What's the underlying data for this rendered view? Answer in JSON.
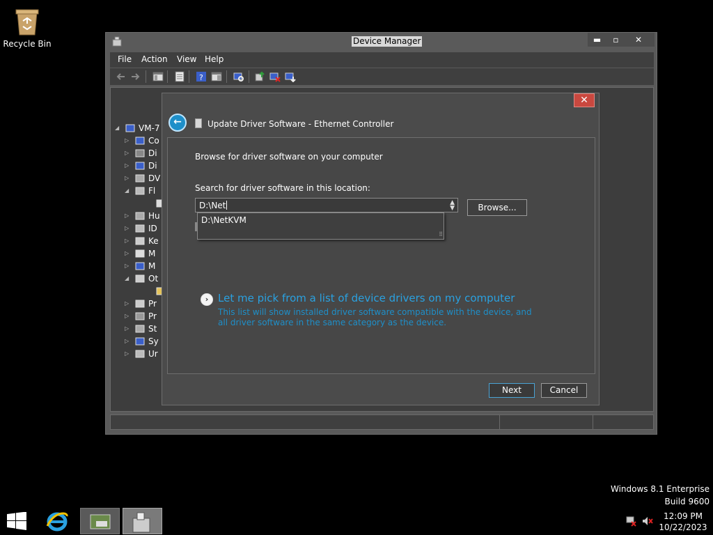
{
  "desktop": {
    "recycle_bin_label": "Recycle Bin"
  },
  "device_manager": {
    "title": "Device Manager",
    "window_buttons": {
      "minimize": "▬",
      "maximize": "▫",
      "close": "✕"
    },
    "menu": [
      "File",
      "Action",
      "View",
      "Help"
    ],
    "tree": [
      {
        "label": "VM-7",
        "arrow": "◢",
        "icon": "computer-icon"
      },
      {
        "label": "Co",
        "arrow": "▷",
        "icon": "computer-icon"
      },
      {
        "label": "Di",
        "arrow": "▷",
        "icon": "disk-drive-icon"
      },
      {
        "label": "Di",
        "arrow": "▷",
        "icon": "display-adapter-icon"
      },
      {
        "label": "DV",
        "arrow": "▷",
        "icon": "dvd-drive-icon"
      },
      {
        "label": "Fl",
        "arrow": "◢",
        "icon": "floppy-controller-icon"
      },
      {
        "label": "",
        "arrow": "",
        "icon": "floppy-drive-icon"
      },
      {
        "label": "Hu",
        "arrow": "▷",
        "icon": "hid-icon"
      },
      {
        "label": "ID",
        "arrow": "▷",
        "icon": "ide-controller-icon"
      },
      {
        "label": "Ke",
        "arrow": "▷",
        "icon": "keyboard-icon"
      },
      {
        "label": "M",
        "arrow": "▷",
        "icon": "mouse-icon"
      },
      {
        "label": "M",
        "arrow": "▷",
        "icon": "monitor-icon"
      },
      {
        "label": "Ot",
        "arrow": "◢",
        "icon": "other-devices-icon"
      },
      {
        "label": "",
        "arrow": "",
        "icon": "unknown-device-warning-icon"
      },
      {
        "label": "Pr",
        "arrow": "▷",
        "icon": "printer-icon"
      },
      {
        "label": "Pr",
        "arrow": "▷",
        "icon": "processor-icon"
      },
      {
        "label": "St",
        "arrow": "▷",
        "icon": "storage-controller-icon"
      },
      {
        "label": "Sy",
        "arrow": "▷",
        "icon": "system-devices-icon"
      },
      {
        "label": "Ur",
        "arrow": "▷",
        "icon": "usb-controller-icon"
      }
    ]
  },
  "dialog": {
    "title": "Update Driver Software - Ethernet Controller",
    "close": "✕",
    "back": "←",
    "heading": "Browse for driver software on your computer",
    "search_label": "Search for driver software in this location:",
    "path_value": "D:\\Net",
    "autocomplete_option": "D:\\NetKVM",
    "browse_label": "Browse...",
    "pick_link": "Let me pick from a list of device drivers on my computer",
    "pick_description": "This list will show installed driver software compatible with the device, and all driver software in the same category as the device.",
    "next_label": "Next",
    "cancel_label": "Cancel"
  },
  "watermark": {
    "line1": "Windows 8.1 Enterprise",
    "line2": "Build 9600"
  },
  "taskbar": {
    "time": "12:09 PM",
    "date": "10/22/2023"
  },
  "colors": {
    "link": "#2aa1e0",
    "close": "#c9483f",
    "accent": "#1e8fc9"
  }
}
